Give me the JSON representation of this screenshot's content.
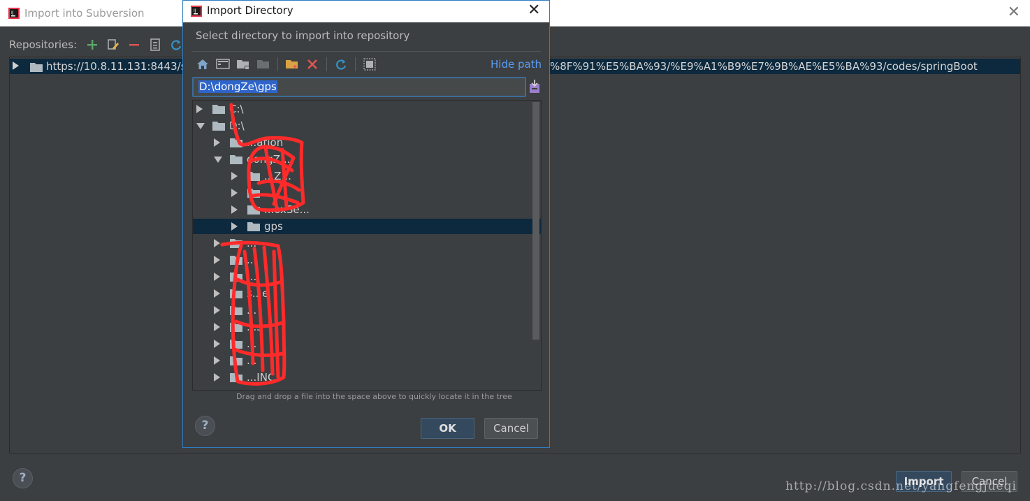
{
  "background_window": {
    "title": "Import into Subversion",
    "repositories_label": "Repositories:",
    "repo_url_left": "https://10.8.11.131:8443/sv",
    "repo_url_right": "%8F%91%E5%BA%93/%E9%A1%B9%E7%9B%AE%E5%BA%93/codes/springBoot",
    "help_label": "?",
    "import_label": "Import",
    "cancel_label": "Cancel"
  },
  "dialog": {
    "title": "Import Directory",
    "subtitle": "Select directory to import into repository",
    "hide_path_label": "Hide path",
    "path_value": "D:\\dongZe\\gps",
    "tree": [
      {
        "label": "C:\\",
        "depth": 0,
        "state": "collapsed",
        "selected": false
      },
      {
        "label": "D:\\",
        "depth": 0,
        "state": "expanded",
        "selected": false
      },
      {
        "label": "...ation",
        "depth": 1,
        "state": "collapsed",
        "selected": false
      },
      {
        "label": "dongZ...",
        "depth": 1,
        "state": "expanded",
        "selected": false
      },
      {
        "label": "...Z...",
        "depth": 2,
        "state": "collapsed",
        "selected": false
      },
      {
        "label": "...",
        "depth": 2,
        "state": "collapsed",
        "selected": false
      },
      {
        "label": "...oxSe...",
        "depth": 2,
        "state": "collapsed",
        "selected": false
      },
      {
        "label": "gps",
        "depth": 2,
        "state": "collapsed",
        "selected": true
      },
      {
        "label": "...",
        "depth": 1,
        "state": "collapsed",
        "selected": false
      },
      {
        "label": "...",
        "depth": 1,
        "state": "collapsed",
        "selected": false
      },
      {
        "label": "...",
        "depth": 1,
        "state": "collapsed",
        "selected": false
      },
      {
        "label": "s...e",
        "depth": 1,
        "state": "collapsed",
        "selected": false
      },
      {
        "label": "...",
        "depth": 1,
        "state": "collapsed",
        "selected": false
      },
      {
        "label": "...s",
        "depth": 1,
        "state": "collapsed",
        "selected": false
      },
      {
        "label": "...",
        "depth": 1,
        "state": "collapsed",
        "selected": false
      },
      {
        "label": "...",
        "depth": 1,
        "state": "collapsed",
        "selected": false
      },
      {
        "label": "...INC",
        "depth": 1,
        "state": "collapsed",
        "selected": false
      }
    ],
    "drag_hint": "Drag and drop a file into the space above to quickly locate it in the tree",
    "help_label": "?",
    "ok_label": "OK",
    "cancel_label": "Cancel"
  },
  "watermark": "http://blog.csdn.net/yangfengjueqi",
  "colors": {
    "background": "#3c3f41",
    "selection": "#0d293e",
    "link": "#589df6",
    "dialog_border": "#2e7dc2",
    "scribble": "#ff2a2a"
  },
  "icons": {
    "background_toolbar": [
      "add-icon",
      "edit-icon",
      "remove-icon",
      "properties-icon",
      "refresh-icon"
    ],
    "dialog_toolbar": [
      "home-icon",
      "desktop-icon",
      "project-folder-icon",
      "module-folder-icon",
      "new-folder-icon",
      "delete-icon",
      "refresh-icon",
      "show-hidden-icon"
    ]
  }
}
